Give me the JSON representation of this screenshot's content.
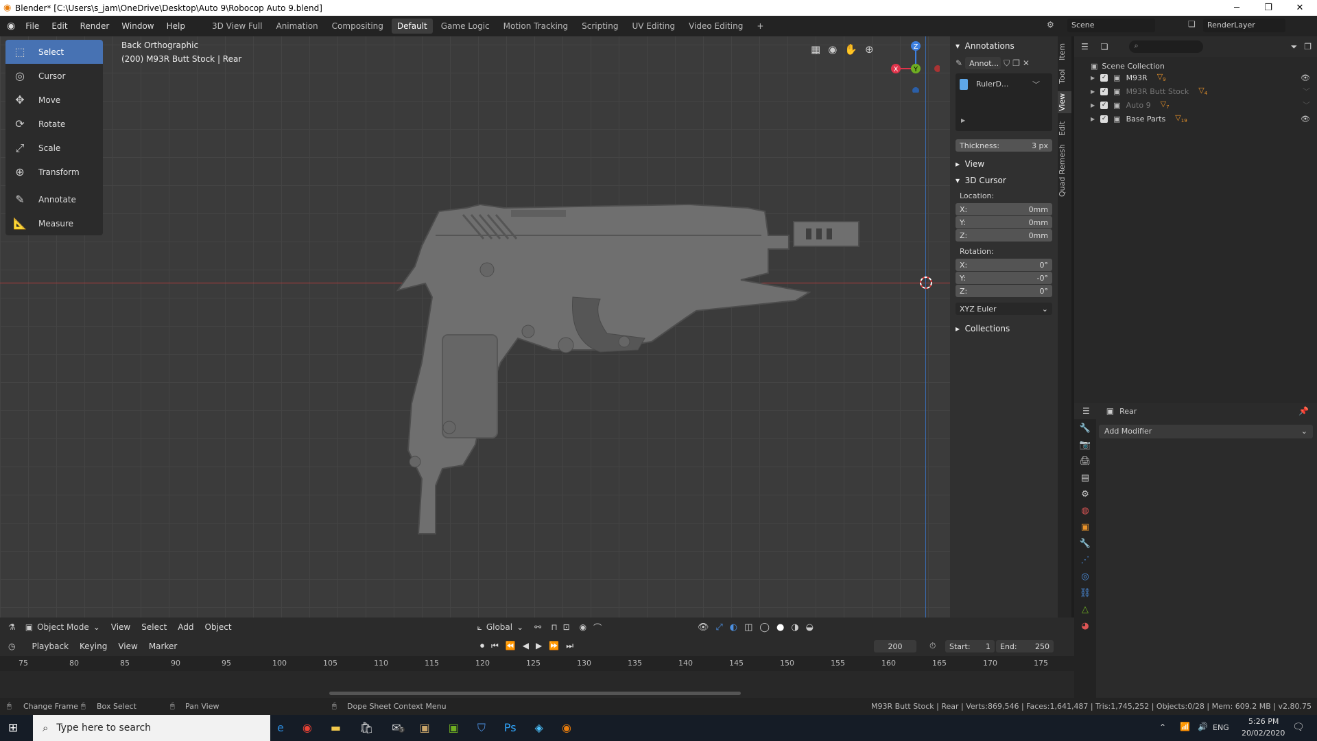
{
  "window": {
    "title": "Blender* [C:\\Users\\s_jam\\OneDrive\\Desktop\\Auto 9\\Robocop Auto 9.blend]"
  },
  "menu": [
    "File",
    "Edit",
    "Render",
    "Window",
    "Help"
  ],
  "workspaces": [
    "3D View Full",
    "Animation",
    "Compositing",
    "Default",
    "Game Logic",
    "Motion Tracking",
    "Scripting",
    "UV Editing",
    "Video Editing"
  ],
  "active_workspace": "Default",
  "scene": {
    "name": "Scene",
    "render_layer": "RenderLayer"
  },
  "viewport": {
    "view_name": "Back Orthographic",
    "object_info": "(200) M93R Butt Stock | Rear"
  },
  "tools": [
    {
      "label": "Select",
      "icon": "select-box-icon",
      "glyph": "⬚"
    },
    {
      "label": "Cursor",
      "icon": "cursor-icon",
      "glyph": "◎"
    },
    {
      "label": "Move",
      "icon": "move-icon",
      "glyph": "✥"
    },
    {
      "label": "Rotate",
      "icon": "rotate-icon",
      "glyph": "⟳"
    },
    {
      "label": "Scale",
      "icon": "scale-icon",
      "glyph": "⤢"
    },
    {
      "label": "Transform",
      "icon": "transform-icon",
      "glyph": "⊕"
    },
    {
      "label": "Annotate",
      "icon": "annotate-icon",
      "glyph": "✎"
    },
    {
      "label": "Measure",
      "icon": "measure-icon",
      "glyph": "📐"
    }
  ],
  "npanel": {
    "annotations": "Annotations",
    "annot_layer": "Annot...",
    "ruler": "RulerD...",
    "thickness_label": "Thickness:",
    "thickness_value": "3 px",
    "view": "View",
    "cursor_section": "3D Cursor",
    "location_label": "Location:",
    "loc_x_label": "X:",
    "loc_x": "0mm",
    "loc_y_label": "Y:",
    "loc_y": "0mm",
    "loc_z_label": "Z:",
    "loc_z": "0mm",
    "rotation_label": "Rotation:",
    "rot_x_label": "X:",
    "rot_x": "0°",
    "rot_y_label": "Y:",
    "rot_y": "-0°",
    "rot_z_label": "Z:",
    "rot_z": "0°",
    "rotation_mode": "XYZ Euler",
    "collections": "Collections"
  },
  "vtabs": [
    "Item",
    "Tool",
    "View",
    "Edit",
    "Quad Remesh"
  ],
  "outliner": {
    "root": "Scene Collection",
    "items": [
      {
        "name": "M93R",
        "count": "9",
        "dim": false
      },
      {
        "name": "M93R Butt Stock",
        "count": "4",
        "dim": true
      },
      {
        "name": "Auto 9",
        "count": "7",
        "dim": true
      },
      {
        "name": "Base Parts",
        "count": "19",
        "dim": false
      }
    ]
  },
  "properties": {
    "object_name": "Rear",
    "add_modifier": "Add Modifier"
  },
  "viewport_header": {
    "mode": "Object Mode",
    "menus": [
      "View",
      "Select",
      "Add",
      "Object"
    ],
    "orientation": "Global"
  },
  "timeline": {
    "menus": [
      "Playback",
      "Keying",
      "View",
      "Marker"
    ],
    "current_frame": "200",
    "start_label": "Start:",
    "start": "1",
    "end_label": "End:",
    "end": "250",
    "ticks": [
      "75",
      "80",
      "85",
      "90",
      "95",
      "100",
      "105",
      "110",
      "115",
      "120",
      "125",
      "130",
      "135",
      "140",
      "145",
      "150",
      "155",
      "160",
      "165",
      "170",
      "175"
    ]
  },
  "statusbar": {
    "change_frame": "Change Frame",
    "box_select": "Box Select",
    "pan_view": "Pan View",
    "context_menu": "Dope Sheet Context Menu",
    "stats": "M93R Butt Stock | Rear | Verts:869,546 | Faces:1,641,487 | Tris:1,745,252 | Objects:0/28 | Mem: 609.2 MB | v2.80.75"
  },
  "taskbar": {
    "search_placeholder": "Type here to search",
    "lang": "ENG",
    "time": "5:26 PM",
    "date": "20/02/2020",
    "mail_badge": "5"
  },
  "colors": {
    "accent": "#4772b3",
    "x_axis": "#e0334a",
    "y_axis": "#6fae22",
    "z_axis": "#3c7fe0",
    "viewport_bg": "#3b3b3b"
  }
}
